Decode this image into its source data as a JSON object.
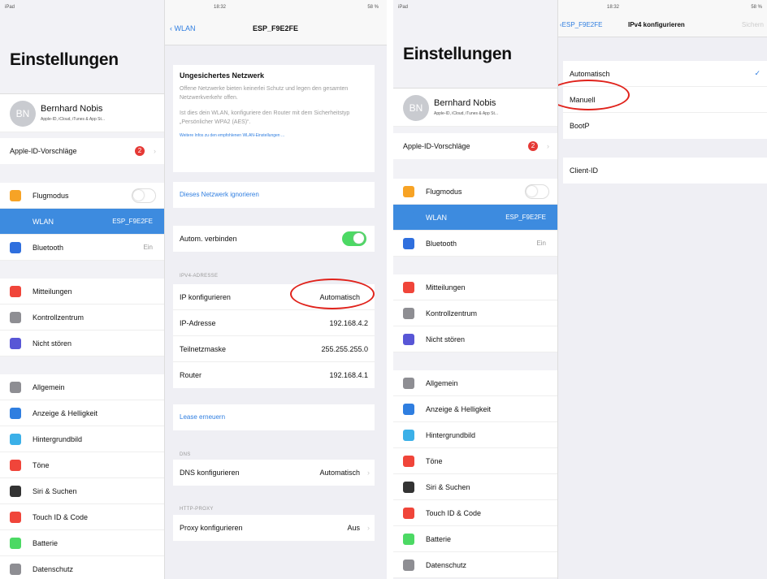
{
  "left": {
    "status_ipad": "iPad",
    "status_time": "18:32",
    "status_battery": "58 %",
    "sidebar_title": "Einstellungen",
    "profile_initials": "BN",
    "profile_name": "Bernhard Nobis",
    "profile_sub": "Apple-ID, iCloud, iTunes & App St...",
    "suggestions_label": "Apple-ID-Vorschläge",
    "suggestions_badge": "2",
    "items": [
      {
        "label": "Flugmodus",
        "value": "",
        "color": "#f7a325",
        "icon": "airplane-icon"
      },
      {
        "label": "WLAN",
        "value": "ESP_F9E2FE",
        "color": "#3d8bdf",
        "icon": "wifi-icon"
      },
      {
        "label": "Bluetooth",
        "value": "Ein",
        "color": "#2f6fde",
        "icon": "bluetooth-icon"
      },
      {
        "label": "Mitteilungen",
        "value": "",
        "color": "#f0453a",
        "icon": "notifications-icon"
      },
      {
        "label": "Kontrollzentrum",
        "value": "",
        "color": "#8e8e93",
        "icon": "control-center-icon"
      },
      {
        "label": "Nicht stören",
        "value": "",
        "color": "#5856d6",
        "icon": "moon-icon"
      },
      {
        "label": "Allgemein",
        "value": "",
        "color": "#8e8e93",
        "icon": "gear-icon"
      },
      {
        "label": "Anzeige & Helligkeit",
        "value": "",
        "color": "#2f7ee0",
        "icon": "display-icon"
      },
      {
        "label": "Hintergrundbild",
        "value": "",
        "color": "#3bb0e8",
        "icon": "wallpaper-icon"
      },
      {
        "label": "Töne",
        "value": "",
        "color": "#f0453a",
        "icon": "speaker-icon"
      },
      {
        "label": "Siri & Suchen",
        "value": "",
        "color": "#333",
        "icon": "siri-icon"
      },
      {
        "label": "Touch ID & Code",
        "value": "",
        "color": "#f0453a",
        "icon": "fingerprint-icon"
      },
      {
        "label": "Batterie",
        "value": "",
        "color": "#4cd964",
        "icon": "battery-icon"
      },
      {
        "label": "Datenschutz",
        "value": "",
        "color": "#8e8e93",
        "icon": "hand-icon"
      }
    ],
    "nav_back": "WLAN",
    "nav_title": "ESP_F9E2FE",
    "warning_title": "Ungesichertes Netzwerk",
    "warning_p1": "Offene Netzwerke bieten keinerlei Schutz und legen den gesamten Netzwerkverkehr offen.",
    "warning_p2": "Ist dies dein WLAN, konfiguriere den Router mit dem Sicherheitstyp „Persönlicher WPA2 (AES)“.",
    "warning_link": "Weitere Infos zu den empfohlenen WLAN-Einstellungen ...",
    "ignore_link": "Dieses Netzwerk ignorieren",
    "auto_join_label": "Autom. verbinden",
    "ipv4_header": "IPV4-ADRESSE",
    "ip_config_label": "IP konfigurieren",
    "ip_config_value": "Automatisch",
    "ip_address_label": "IP-Adresse",
    "ip_address_value": "192.168.4.2",
    "subnet_label": "Teilnetzmaske",
    "subnet_value": "255.255.255.0",
    "router_label": "Router",
    "router_value": "192.168.4.1",
    "lease_link": "Lease erneuern",
    "dns_header": "DNS",
    "dns_label": "DNS konfigurieren",
    "dns_value": "Automatisch",
    "proxy_header": "HTTP-PROXY",
    "proxy_label": "Proxy konfigurieren",
    "proxy_value": "Aus"
  },
  "right": {
    "nav_back": "ESP_F9E2FE",
    "nav_title": "IPv4 konfigurieren",
    "nav_save": "Sichern",
    "options": [
      "Automatisch",
      "Manuell",
      "BootP"
    ],
    "checkmark": "✓",
    "client_id_label": "Client-ID"
  }
}
